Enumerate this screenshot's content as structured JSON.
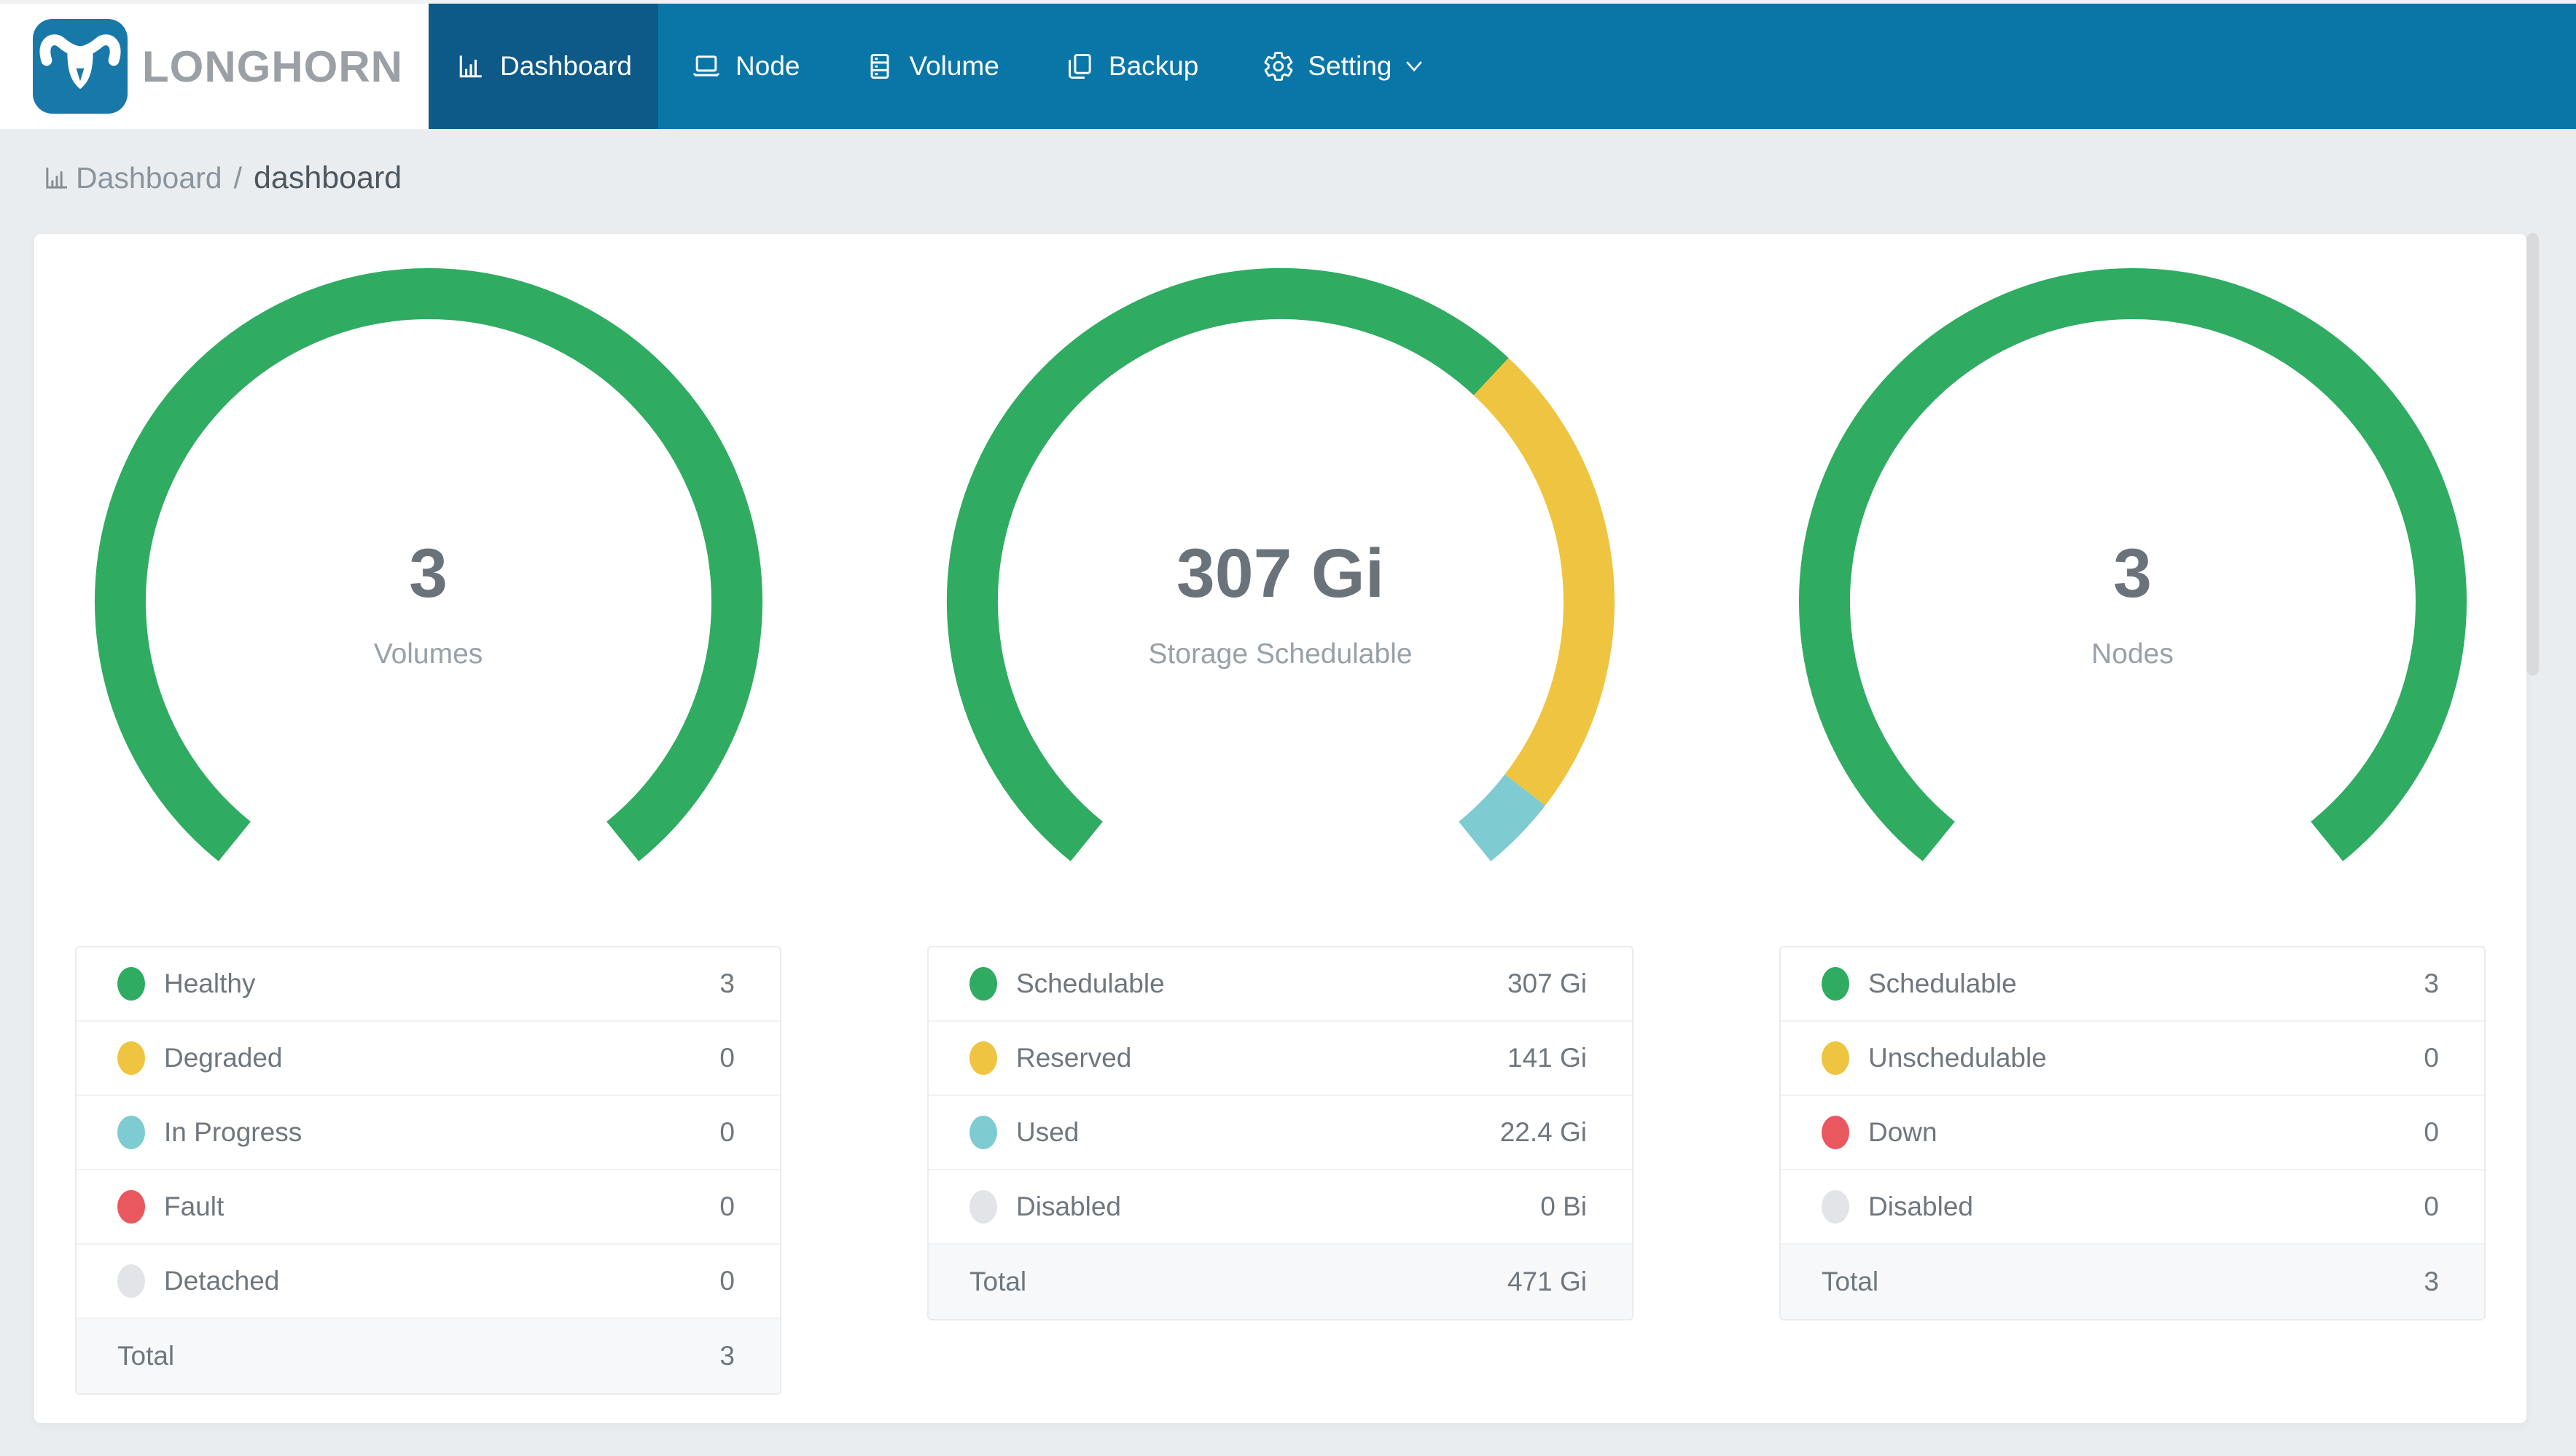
{
  "brand": {
    "name": "LONGHORN"
  },
  "nav": {
    "items": [
      {
        "label": "Dashboard",
        "icon": "bar-chart",
        "active": true
      },
      {
        "label": "Node",
        "icon": "laptop",
        "active": false
      },
      {
        "label": "Volume",
        "icon": "database",
        "active": false
      },
      {
        "label": "Backup",
        "icon": "copy",
        "active": false
      },
      {
        "label": "Setting",
        "icon": "gear",
        "active": false,
        "caret": true
      }
    ]
  },
  "breadcrumb": {
    "icon": "bar-chart",
    "section": "Dashboard",
    "separator": "/",
    "page": "dashboard"
  },
  "colors": {
    "green": "#30ab62",
    "yellow": "#efc440",
    "teal": "#7ecbd1",
    "red": "#e9585f",
    "gray": "#e2e4e7",
    "nav_blue": "#0a76a8",
    "nav_active_blue": "#0d5a88",
    "brand_gray": "#9aa0a5"
  },
  "chart_data": [
    {
      "type": "donut",
      "center_value": "3",
      "center_caption": "Volumes",
      "arc": {
        "start_deg": 219,
        "span_deg": 282,
        "thickness": 70
      },
      "segments": [
        {
          "label": "Healthy",
          "color": "green",
          "value": 3,
          "display": "3"
        },
        {
          "label": "Degraded",
          "color": "yellow",
          "value": 0,
          "display": "0"
        },
        {
          "label": "In Progress",
          "color": "teal",
          "value": 0,
          "display": "0"
        },
        {
          "label": "Fault",
          "color": "red",
          "value": 0,
          "display": "0"
        },
        {
          "label": "Detached",
          "color": "gray",
          "value": 0,
          "display": "0"
        }
      ],
      "total": {
        "label": "Total",
        "display": "3"
      }
    },
    {
      "type": "donut",
      "center_value": "307 Gi",
      "center_caption": "Storage Schedulable",
      "arc": {
        "start_deg": 219,
        "span_deg": 282,
        "thickness": 70
      },
      "segments": [
        {
          "label": "Schedulable",
          "color": "green",
          "value": 307,
          "display": "307 Gi"
        },
        {
          "label": "Reserved",
          "color": "yellow",
          "value": 141,
          "display": "141 Gi"
        },
        {
          "label": "Used",
          "color": "teal",
          "value": 22.4,
          "display": "22.4 Gi"
        },
        {
          "label": "Disabled",
          "color": "gray",
          "value": 0,
          "display": "0 Bi"
        }
      ],
      "total": {
        "label": "Total",
        "display": "471 Gi"
      }
    },
    {
      "type": "donut",
      "center_value": "3",
      "center_caption": "Nodes",
      "arc": {
        "start_deg": 219,
        "span_deg": 282,
        "thickness": 70
      },
      "segments": [
        {
          "label": "Schedulable",
          "color": "green",
          "value": 3,
          "display": "3"
        },
        {
          "label": "Unschedulable",
          "color": "yellow",
          "value": 0,
          "display": "0"
        },
        {
          "label": "Down",
          "color": "red",
          "value": 0,
          "display": "0"
        },
        {
          "label": "Disabled",
          "color": "gray",
          "value": 0,
          "display": "0"
        }
      ],
      "total": {
        "label": "Total",
        "display": "3"
      }
    }
  ]
}
